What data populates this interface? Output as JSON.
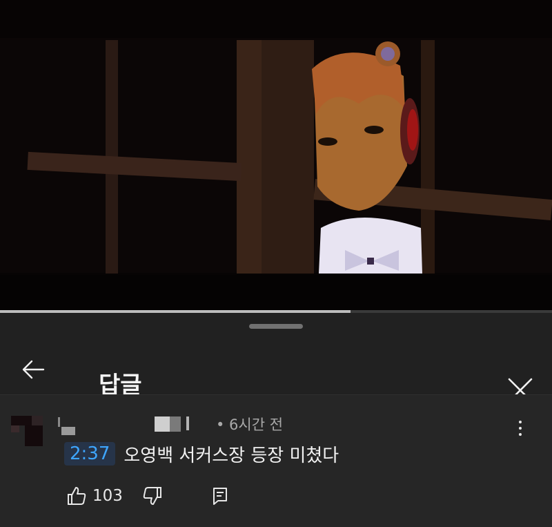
{
  "video": {
    "progress": 0.635
  },
  "header": {
    "title": "답글",
    "back_icon": "arrow-left-icon",
    "close_icon": "close-icon"
  },
  "comment": {
    "time": "• 6시간 전",
    "timestamp": "2:37",
    "text": "오영백 서커스장 등장 미쳤다",
    "likes": "103",
    "more_icon": "more-vert-icon"
  },
  "colors": {
    "background": "#212121",
    "timestamp_link": "#3ea6ff",
    "timestamp_bg": "#263449"
  }
}
